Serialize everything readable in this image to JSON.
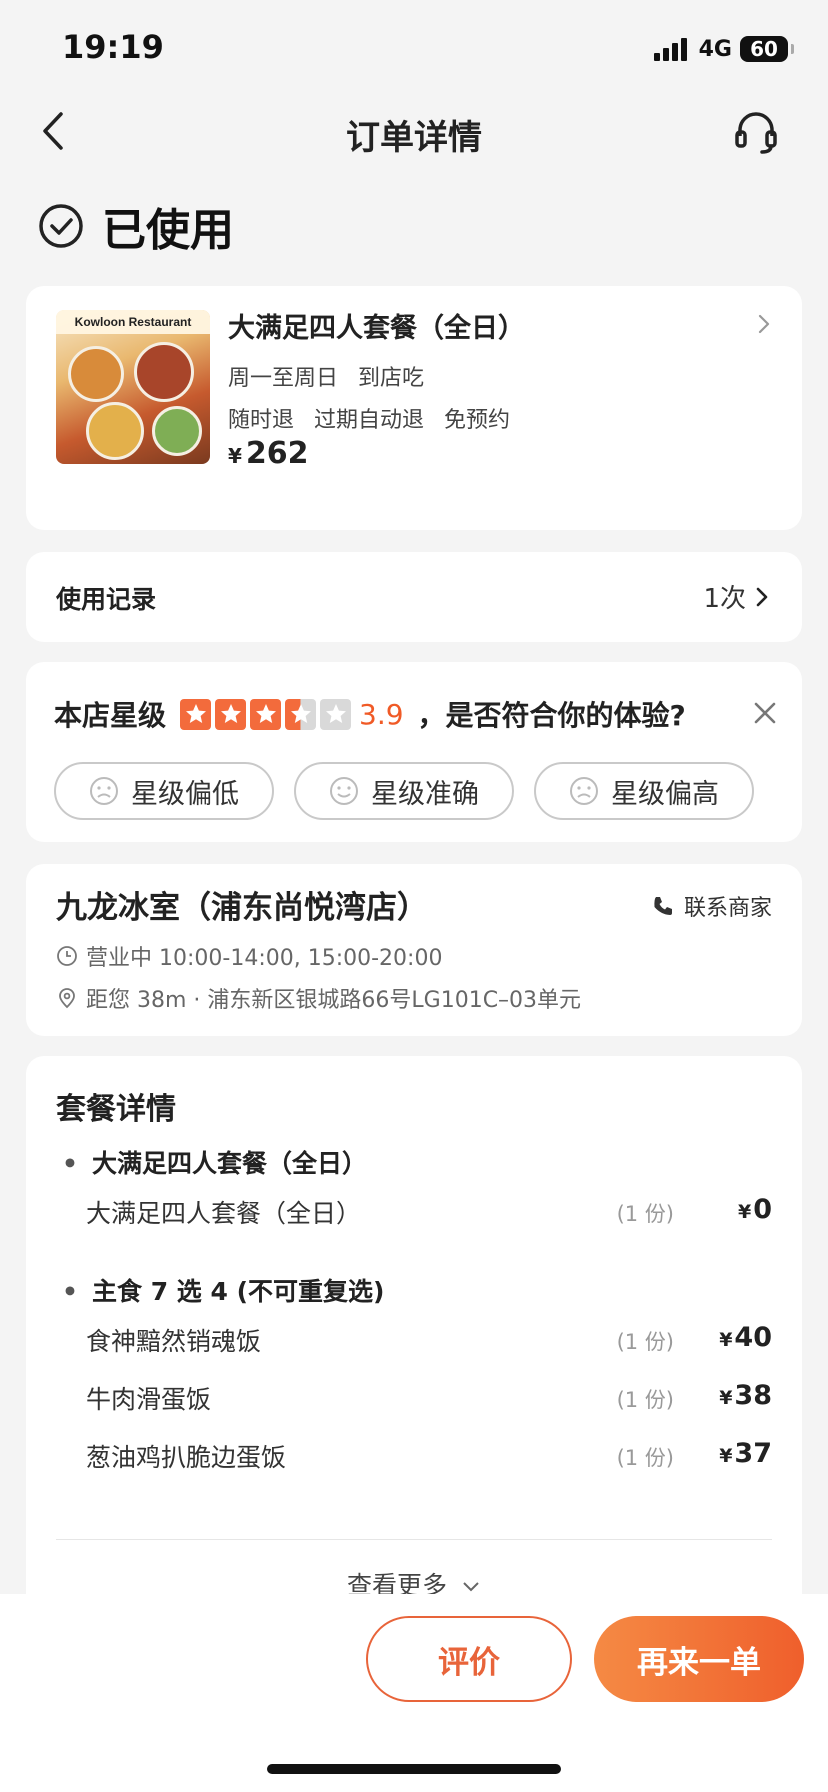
{
  "status_bar": {
    "time": "19:19",
    "network": "4G",
    "battery": "60"
  },
  "nav": {
    "title": "订单详情"
  },
  "order_status": {
    "text": "已使用"
  },
  "deal": {
    "image_caption": "Kowloon Restaurant",
    "title": "大满足四人套餐（全日）",
    "line1": [
      "周一至周日",
      "到店吃"
    ],
    "line2": [
      "随时退",
      "过期自动退",
      "免预约"
    ],
    "currency": "¥",
    "price": "262"
  },
  "usage_record": {
    "label": "使用记录",
    "count": "1次"
  },
  "rating": {
    "label": "本店星级",
    "value": "3.9",
    "stars_filled": 3.5,
    "stars_total": 5,
    "question": "，是否符合你的体验?",
    "options": [
      "星级偏低",
      "星级准确",
      "星级偏高"
    ]
  },
  "shop": {
    "name": "九龙冰室（浦东尚悦湾店）",
    "contact": "联系商家",
    "hours": "营业中 10:00-14:00, 15:00-20:00",
    "address": "距您 38m · 浦东新区银城路66号LG101C–03单元"
  },
  "package": {
    "title": "套餐详情",
    "groups": [
      {
        "name": "大满足四人套餐（全日）",
        "items": [
          {
            "name": "大满足四人套餐（全日）",
            "qty": "(1 份)",
            "currency": "¥",
            "price": "0"
          }
        ]
      },
      {
        "name": "主食 7 选 4 (不可重复选)",
        "items": [
          {
            "name": "食神黯然销魂饭",
            "qty": "(1 份)",
            "currency": "¥",
            "price": "40"
          },
          {
            "name": "牛肉滑蛋饭",
            "qty": "(1 份)",
            "currency": "¥",
            "price": "38"
          },
          {
            "name": "葱油鸡扒脆边蛋饭",
            "qty": "(1 份)",
            "currency": "¥",
            "price": "37"
          }
        ]
      }
    ],
    "more": "查看更多"
  },
  "actions": {
    "review": "评价",
    "reorder": "再来一单"
  },
  "colors": {
    "accent": "#ef5f2c",
    "star": "#f36b3c",
    "background": "#f4f4f4"
  }
}
